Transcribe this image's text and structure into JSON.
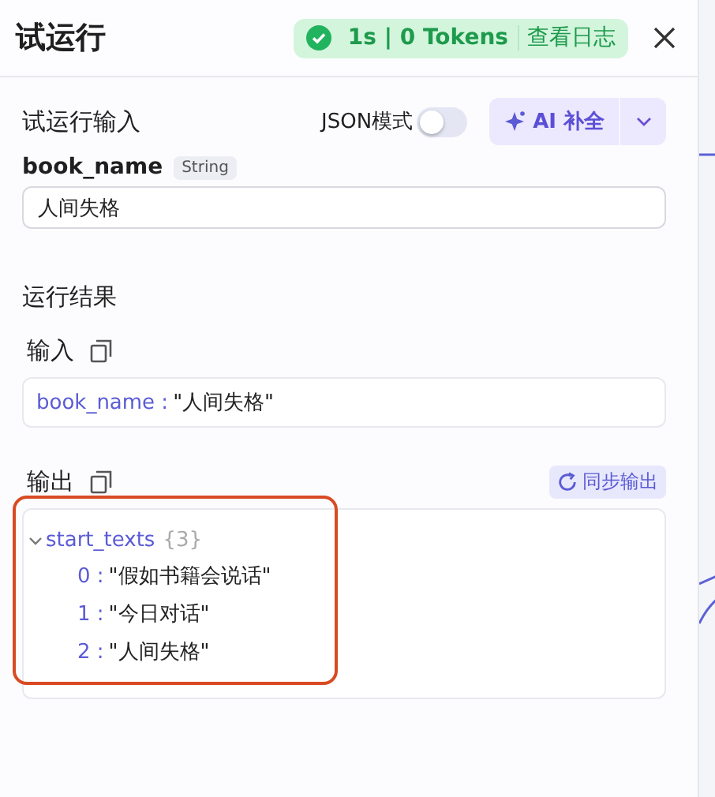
{
  "header": {
    "title": "试运行",
    "status": {
      "ok": true,
      "summary": "1s | 0 Tokens",
      "log_link": "查看日志"
    }
  },
  "run_input": {
    "heading": "试运行输入",
    "json_mode": {
      "label": "JSON模式",
      "on": false
    },
    "ai_button": "AI 补全",
    "fields": [
      {
        "name": "book_name",
        "type": "String",
        "value": "人间失格"
      }
    ]
  },
  "results": {
    "heading": "运行结果",
    "input": {
      "label": "输入",
      "entries": [
        {
          "key": "book_name :",
          "value": "\"人间失格\""
        }
      ]
    },
    "output": {
      "label": "输出",
      "sync_button": "同步输出",
      "highlight": {
        "kind": "box"
      },
      "tree": [
        {
          "key": "start_texts",
          "count": "{3}",
          "expanded": true,
          "children": [
            {
              "key": "0 :",
              "value": "\"假如书籍会说话\""
            },
            {
              "key": "1 :",
              "value": "\"今日对话\""
            },
            {
              "key": "2 :",
              "value": "\"人间失格\""
            }
          ]
        }
      ]
    }
  }
}
